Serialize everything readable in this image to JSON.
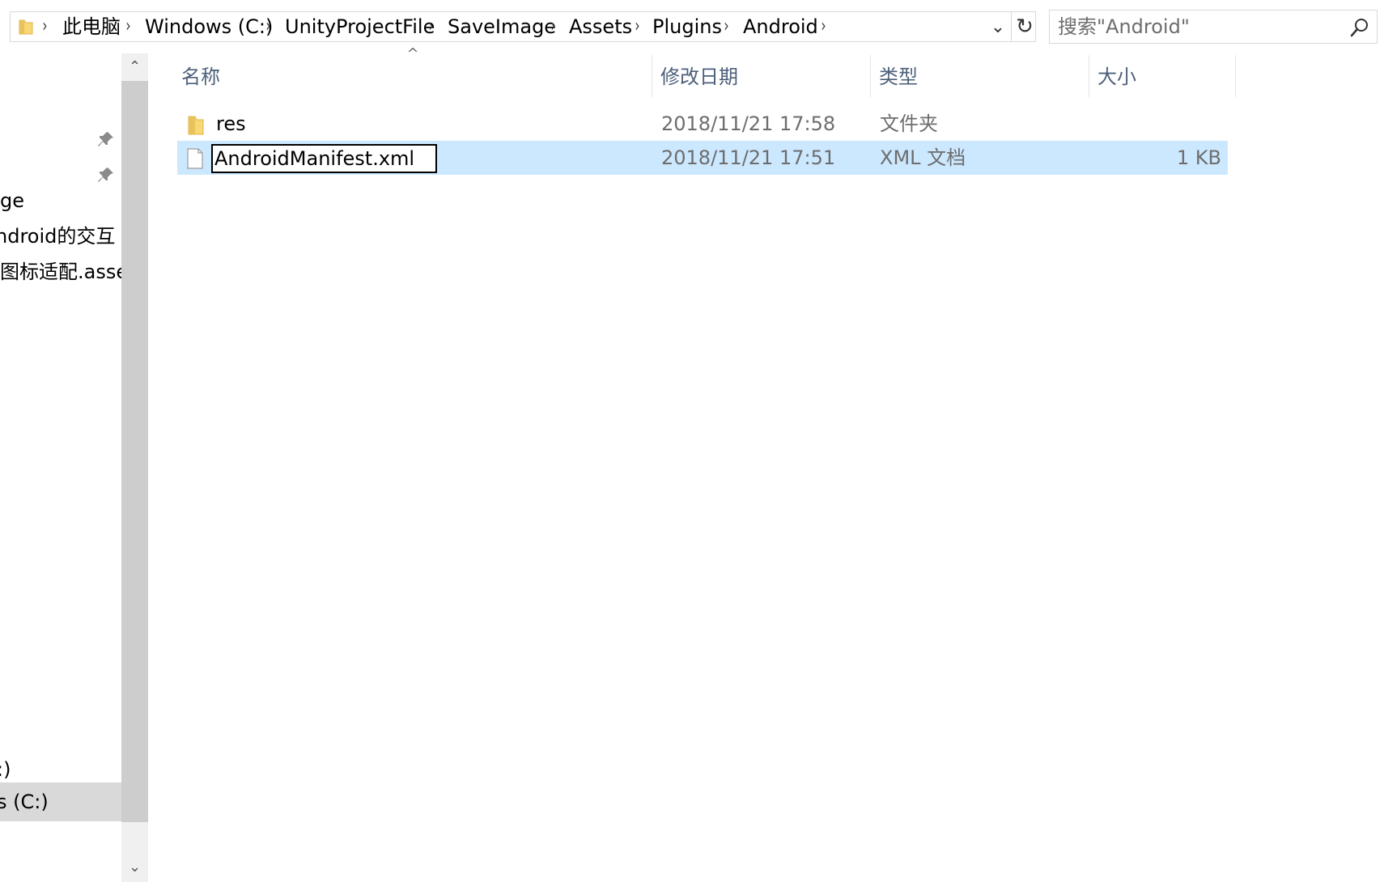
{
  "address_bar": {
    "crumbs": [
      "此电脑",
      "Windows (C:)",
      "UnityProjectFile",
      "SaveImage",
      "Assets",
      "Plugins",
      "Android"
    ],
    "separator": "›",
    "dropdown_glyph": "⌄",
    "refresh_glyph": "↻"
  },
  "search": {
    "placeholder": "搜索\"Android\""
  },
  "nav": {
    "items": [
      "ge",
      "ndroid的交互",
      "图标适配.asse",
      "s (C:)",
      ":)"
    ]
  },
  "scrollbar": {
    "up_glyph": "⌃",
    "down_glyph": "⌄"
  },
  "columns": {
    "sort_glyph": "^",
    "name": "名称",
    "date": "修改日期",
    "type": "类型",
    "size": "大小"
  },
  "rows": [
    {
      "name": "res",
      "date": "2018/11/21 17:58",
      "type": "文件夹",
      "size": "",
      "icon": "folder-icon"
    },
    {
      "name": "AndroidManifest.xml",
      "date": "2018/11/21 17:51",
      "type": "XML 文档",
      "size": "1 KB",
      "icon": "file-icon"
    }
  ],
  "colors": {
    "selection": "#cce8ff",
    "header_text": "#4c607a",
    "folder": "#f8d775"
  }
}
